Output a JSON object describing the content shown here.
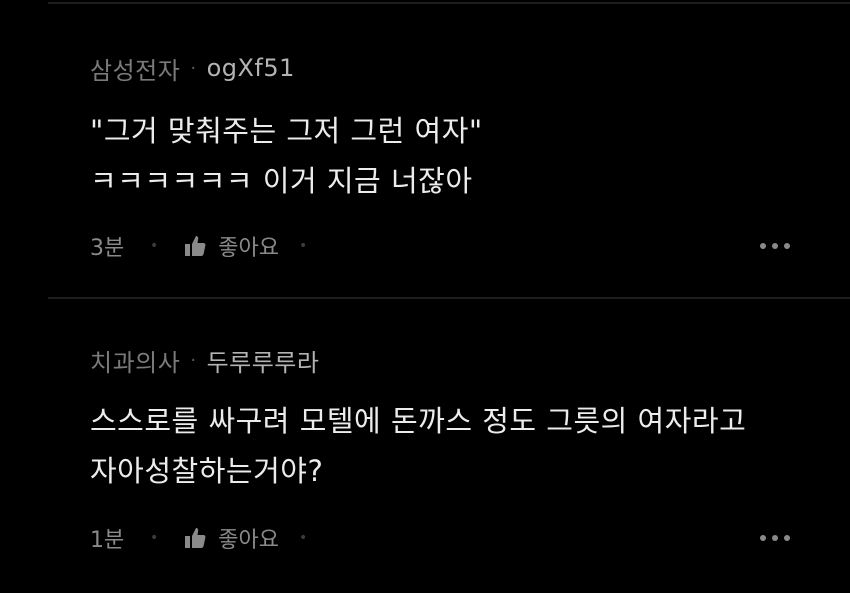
{
  "comments": [
    {
      "author": "삼성전자",
      "separator": "·",
      "user_id": "ogXf51",
      "body": "\"그거 맞춰주는 그저 그런 여자\"\nㅋㅋㅋㅋㅋㅋ 이거 지금 너잖아",
      "time": "3분",
      "like_label": "좋아요"
    },
    {
      "author": "치과의사",
      "separator": "·",
      "user_id": "두루루루라",
      "body": "스스로를 싸구려 모텔에 돈까스 정도 그릇의 여자라고\n자아성찰하는거야?",
      "time": "1분",
      "like_label": "좋아요"
    }
  ],
  "icons": {
    "like": "thumbs-up-icon",
    "more": "more-horizontal-icon"
  },
  "colors": {
    "background": "#000000",
    "body_text": "#ececec",
    "meta_text": "#7a7a7a",
    "user_id_text": "#b3b3b3",
    "divider": "#1e1e1e"
  }
}
